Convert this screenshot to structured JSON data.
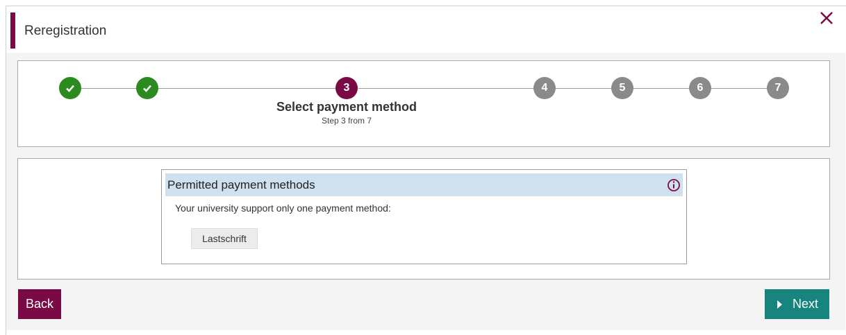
{
  "window": {
    "title": "Reregistration",
    "close_icon": "close-icon"
  },
  "stepper": {
    "steps": [
      {
        "label": "",
        "status": "done"
      },
      {
        "label": "",
        "status": "done"
      },
      {
        "label": "3",
        "status": "current"
      },
      {
        "label": "4",
        "status": "todo"
      },
      {
        "label": "5",
        "status": "todo"
      },
      {
        "label": "6",
        "status": "todo"
      },
      {
        "label": "7",
        "status": "todo"
      }
    ],
    "current_title": "Select payment method",
    "current_sub": "Step 3 from 7"
  },
  "payment": {
    "header": "Permitted payment methods",
    "text": "Your university support only one payment method:",
    "method": "Lastschrift"
  },
  "buttons": {
    "back": "Back",
    "next": "Next"
  },
  "colors": {
    "accent": "#7a0a45",
    "done": "#2b8a20",
    "todo": "#8a8a8a",
    "next": "#17857d",
    "header_bg": "#cfe0ef"
  }
}
